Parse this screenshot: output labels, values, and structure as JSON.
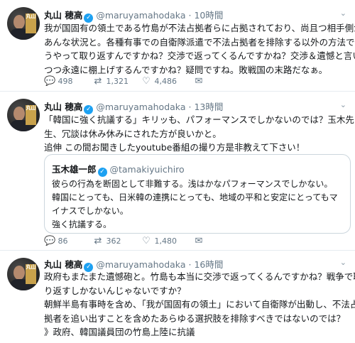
{
  "tweets": [
    {
      "name": "丸山 穂高",
      "handle": "@maruyamahodaka",
      "sep": "·",
      "time": "10時間",
      "lines": [
        "我が国固有の領土である竹島が不法占拠者らに占拠されており、尚且つ相手側が",
        "あんな状況と。各種有事での自衛隊派遣で不法占拠者を排除する以外の方法でど",
        "うやって取り返すんですかね？交渉で返ってくるんですかね？交渉＆遺憾と言い",
        "つつ永遠に棚上げするんですかね？疑問ですね。敗戦国の末路だなぁ。"
      ],
      "replies": "498",
      "retweets": "1,321",
      "likes": "4,486"
    },
    {
      "name": "丸山 穂高",
      "handle": "@maruyamahodaka",
      "sep": "·",
      "time": "13時間",
      "lines": [
        "「韓国に強く抗議する」キリッも、パフォーマンスでしかないのでは？玉木先",
        "生、冗談は休み休みにされた方が良いかと。",
        "追伸 この間お聞きしたyoutube番組の撮り方是非教えて下さい！"
      ],
      "quote": {
        "name": "玉木雄一郎",
        "handle": "@tamakiyuichiro",
        "lines": [
          "彼らの行為を断固として非難する。浅はかなパフォーマンスでしかない。",
          "韓国にとっても、日米韓の連携にとっても、地域の平和と安定にとってもマ",
          "イナスでしかない。",
          "強く抗議する。"
        ]
      },
      "replies": "86",
      "retweets": "362",
      "likes": "1,480"
    },
    {
      "name": "丸山 穂高",
      "handle": "@maruyamahodaka",
      "sep": "·",
      "time": "16時間",
      "lines": [
        "政府もまたまた遺憾砲と。竹島も本当に交渉で返ってくるんですかね？戦争で取",
        "り返すしかないんじゃないですか？",
        "朝鮮半島有事時を含め、「我が国固有の領土」において自衛隊が出動し、不法占",
        "拠者を追い出すことを含めたあらゆる選択肢を排除すべきではないのでは？",
        "》政府、韓国議員団の竹島上陸に抗議"
      ]
    }
  ],
  "avatar_plate": "丸山",
  "icons": {
    "reply": "reply-icon",
    "retweet": "retweet-icon",
    "like": "heart-icon",
    "mail": "mail-icon",
    "more": "chevron-down-icon",
    "verified": "verified-badge-icon"
  },
  "colors": {
    "verified": "#1da1f2",
    "muted": "#657786",
    "border": "#e6ecf0"
  }
}
